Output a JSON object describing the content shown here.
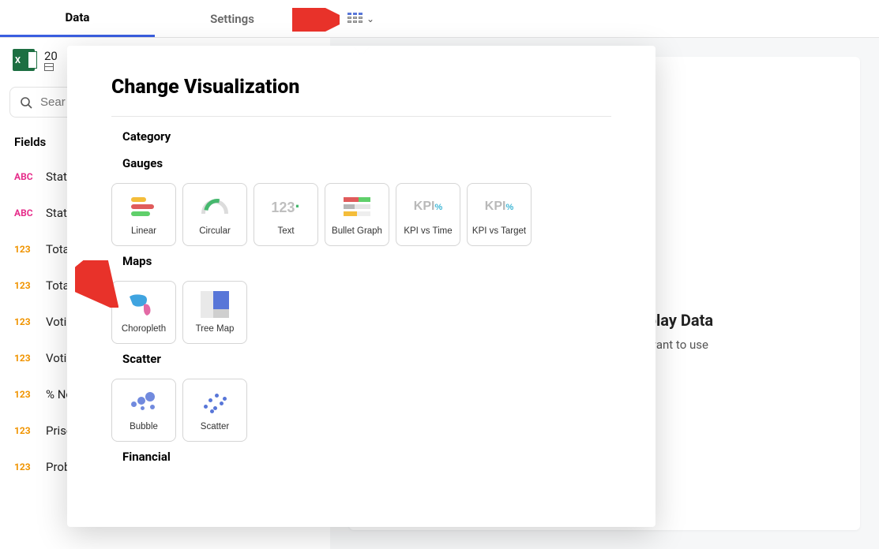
{
  "tabs": {
    "data": "Data",
    "settings": "Settings"
  },
  "datasource": {
    "title": "20",
    "sub": ""
  },
  "search": {
    "placeholder": "Sear"
  },
  "fields_header": "Fields",
  "fields": [
    {
      "type": "ABC",
      "label": "State"
    },
    {
      "type": "ABC",
      "label": "State"
    },
    {
      "type": "123",
      "label": "Total"
    },
    {
      "type": "123",
      "label": "Total"
    },
    {
      "type": "123",
      "label": "Votin"
    },
    {
      "type": "123",
      "label": "Votin"
    },
    {
      "type": "123",
      "label": "% No"
    },
    {
      "type": "123",
      "label": "Priso"
    },
    {
      "type": "123",
      "label": "Proba"
    }
  ],
  "popover": {
    "title": "Change Visualization",
    "categories": {
      "category": "Category",
      "gauges": "Gauges",
      "maps": "Maps",
      "scatter": "Scatter",
      "financial": "Financial"
    },
    "gauges": [
      {
        "key": "linear",
        "label": "Linear"
      },
      {
        "key": "circular",
        "label": "Circular"
      },
      {
        "key": "text",
        "label": "Text"
      },
      {
        "key": "bullet",
        "label": "Bullet Graph"
      },
      {
        "key": "kpitime",
        "label": "KPI vs Time"
      },
      {
        "key": "kpitarget",
        "label": "KPI vs Target"
      }
    ],
    "maps": [
      {
        "key": "choropleth",
        "label": "Choropleth"
      },
      {
        "key": "treemap",
        "label": "Tree Map"
      }
    ],
    "scatterItems": [
      {
        "key": "bubble",
        "label": "Bubble"
      },
      {
        "key": "scatter",
        "label": "Scatter"
      }
    ]
  },
  "drop": {
    "title": "and Drop fields to Display Data",
    "sub": "select the Visualization you want to use"
  }
}
